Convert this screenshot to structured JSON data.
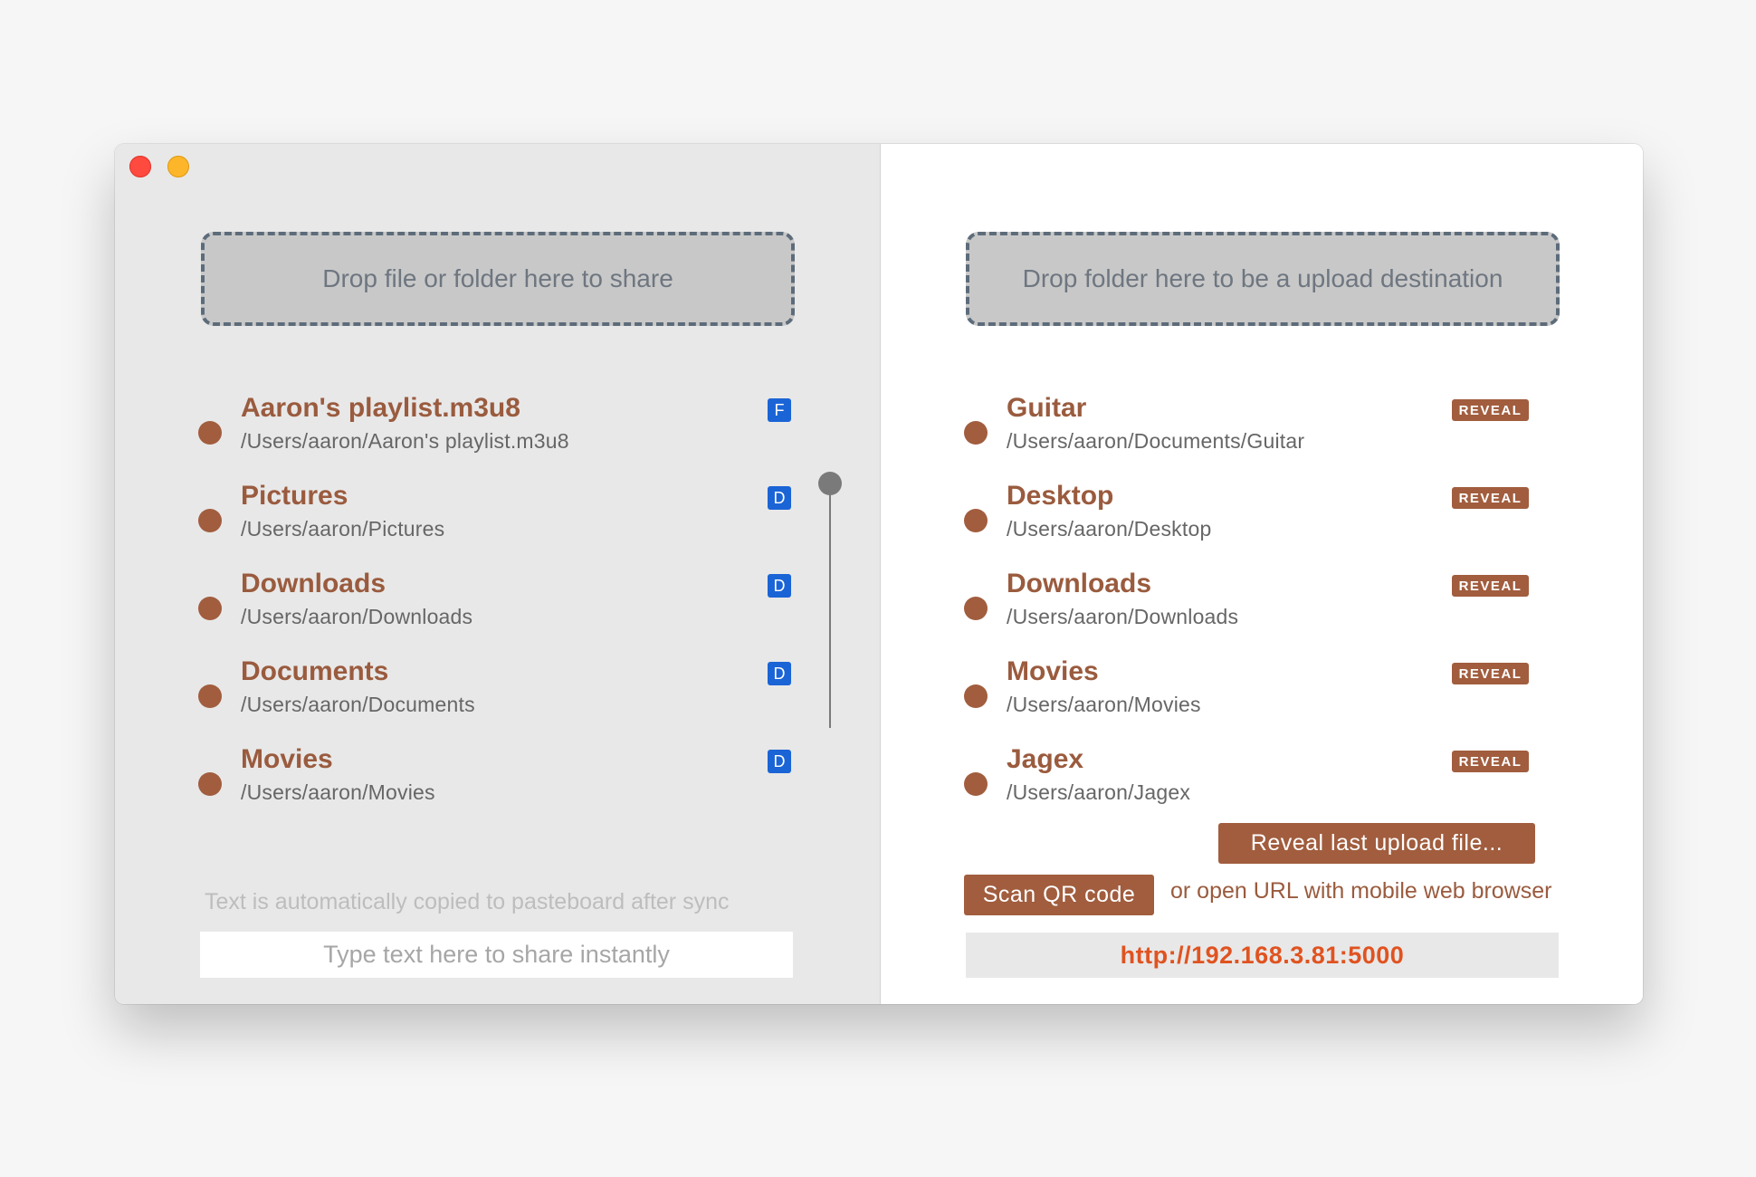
{
  "window": {
    "traffic_lights": [
      "close",
      "minimize"
    ]
  },
  "share_pane": {
    "dropzone_text": "Drop file or folder here to share",
    "items": [
      {
        "name": "Aaron's playlist.m3u8",
        "path": "/Users/aaron/Aaron's playlist.m3u8",
        "badge": "F"
      },
      {
        "name": "Pictures",
        "path": "/Users/aaron/Pictures",
        "badge": "D"
      },
      {
        "name": "Downloads",
        "path": "/Users/aaron/Downloads",
        "badge": "D"
      },
      {
        "name": "Documents",
        "path": "/Users/aaron/Documents",
        "badge": "D"
      },
      {
        "name": "Movies",
        "path": "/Users/aaron/Movies",
        "badge": "D"
      }
    ],
    "hint": "Text is automatically copied to pasteboard after sync",
    "text_input": {
      "value": "",
      "placeholder": "Type text here to share instantly"
    }
  },
  "upload_pane": {
    "dropzone_text": "Drop folder here to be a upload destination",
    "items": [
      {
        "name": "Guitar",
        "path": "/Users/aaron/Documents/Guitar",
        "action": "REVEAL"
      },
      {
        "name": "Desktop",
        "path": "/Users/aaron/Desktop",
        "action": "REVEAL"
      },
      {
        "name": "Downloads",
        "path": "/Users/aaron/Downloads",
        "action": "REVEAL"
      },
      {
        "name": "Movies",
        "path": "/Users/aaron/Movies",
        "action": "REVEAL"
      },
      {
        "name": "Jagex",
        "path": "/Users/aaron/Jagex",
        "action": "REVEAL"
      }
    ],
    "reveal_last_label": "Reveal last upload file...",
    "scan_qr_label": "Scan QR code",
    "or_text": "or open URL with mobile web browser",
    "url": "http://192.168.3.81:5000"
  },
  "colors": {
    "accent": "#a15d3e",
    "badge_blue": "#1a64d6",
    "url_orange": "#e05320",
    "left_bg": "#e8e8e8",
    "right_bg": "#ffffff"
  }
}
